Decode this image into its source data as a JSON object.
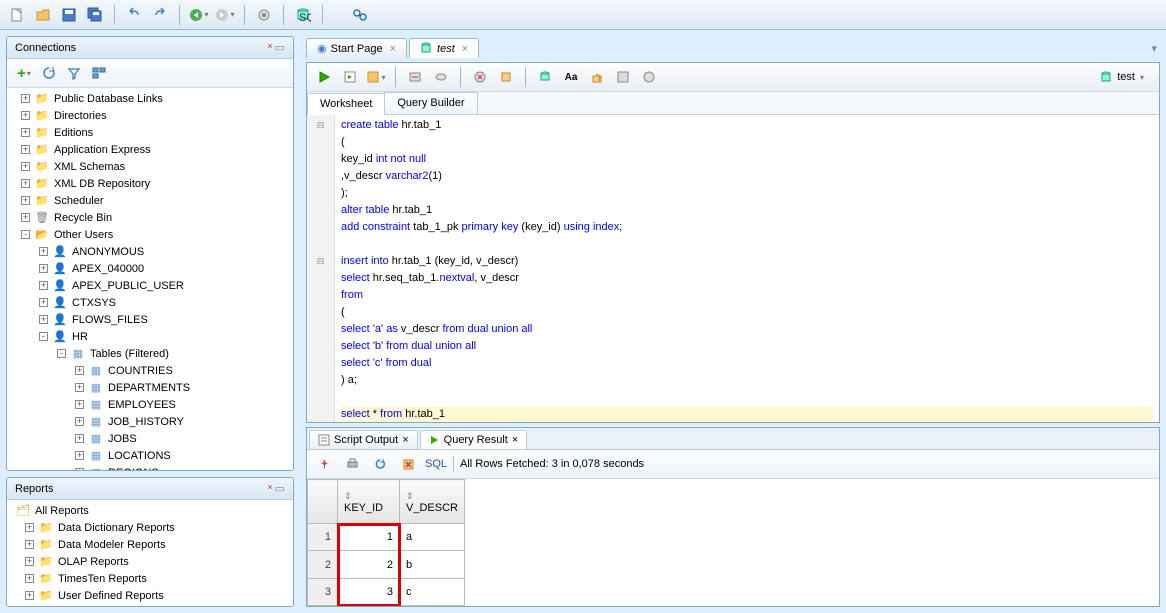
{
  "toolbar_icons": [
    "new",
    "open",
    "save",
    "saveall",
    "undo",
    "redo",
    "back",
    "fwd",
    "cfg",
    "sql",
    "find"
  ],
  "connections": {
    "title": "Connections",
    "tree": [
      {
        "lvl": 0,
        "exp": "+",
        "icon": "folder",
        "label": "Public Database Links"
      },
      {
        "lvl": 0,
        "exp": "+",
        "icon": "folder",
        "label": "Directories"
      },
      {
        "lvl": 0,
        "exp": "+",
        "icon": "folder",
        "label": "Editions"
      },
      {
        "lvl": 0,
        "exp": "+",
        "icon": "folder",
        "label": "Application Express"
      },
      {
        "lvl": 0,
        "exp": "+",
        "icon": "folder",
        "label": "XML Schemas"
      },
      {
        "lvl": 0,
        "exp": "+",
        "icon": "folder",
        "label": "XML DB Repository"
      },
      {
        "lvl": 0,
        "exp": "+",
        "icon": "folder",
        "label": "Scheduler"
      },
      {
        "lvl": 0,
        "exp": "+",
        "icon": "trash",
        "label": "Recycle Bin"
      },
      {
        "lvl": 0,
        "exp": "-",
        "icon": "folder-open",
        "label": "Other Users"
      },
      {
        "lvl": 1,
        "exp": "+",
        "icon": "user",
        "label": "ANONYMOUS"
      },
      {
        "lvl": 1,
        "exp": "+",
        "icon": "user",
        "label": "APEX_040000"
      },
      {
        "lvl": 1,
        "exp": "+",
        "icon": "user",
        "label": "APEX_PUBLIC_USER"
      },
      {
        "lvl": 1,
        "exp": "+",
        "icon": "user",
        "label": "CTXSYS"
      },
      {
        "lvl": 1,
        "exp": "+",
        "icon": "user",
        "label": "FLOWS_FILES"
      },
      {
        "lvl": 1,
        "exp": "-",
        "icon": "user",
        "label": "HR"
      },
      {
        "lvl": 2,
        "exp": "-",
        "icon": "folder-tbl",
        "label": "Tables (Filtered)"
      },
      {
        "lvl": 3,
        "exp": "+",
        "icon": "table",
        "label": "COUNTRIES"
      },
      {
        "lvl": 3,
        "exp": "+",
        "icon": "table",
        "label": "DEPARTMENTS"
      },
      {
        "lvl": 3,
        "exp": "+",
        "icon": "table",
        "label": "EMPLOYEES"
      },
      {
        "lvl": 3,
        "exp": "+",
        "icon": "table",
        "label": "JOB_HISTORY"
      },
      {
        "lvl": 3,
        "exp": "+",
        "icon": "table",
        "label": "JOBS"
      },
      {
        "lvl": 3,
        "exp": "+",
        "icon": "table",
        "label": "LOCATIONS"
      },
      {
        "lvl": 3,
        "exp": "+",
        "icon": "table",
        "label": "REGIONS"
      }
    ]
  },
  "reports": {
    "title": "Reports",
    "root": "All Reports",
    "items": [
      "Data Dictionary Reports",
      "Data Modeler Reports",
      "OLAP Reports",
      "TimesTen Reports",
      "User Defined Reports"
    ]
  },
  "editor": {
    "tabs": [
      {
        "label": "Start Page",
        "icon": "home",
        "active": false
      },
      {
        "label": "test",
        "icon": "sql",
        "active": true
      }
    ],
    "conn_selector": "test",
    "subtabs": [
      {
        "label": "Worksheet",
        "active": true
      },
      {
        "label": "Query Builder",
        "active": false
      }
    ],
    "code_lines": [
      "create table hr.tab_1",
      "(",
      "key_id int not null",
      ",v_descr varchar2(1)",
      ");",
      "alter table hr.tab_1",
      "add constraint tab_1_pk primary key (key_id) using index;",
      "",
      "insert into hr.tab_1 (key_id, v_descr)",
      "select hr.seq_tab_1.nextval, v_descr",
      "from",
      "(",
      "select 'a' as v_descr from dual union all",
      "select 'b' from dual union all",
      "select 'c' from dual",
      ") a;",
      "",
      "select * from hr.tab_1"
    ]
  },
  "results": {
    "tabs": [
      {
        "label": "Script Output",
        "active": false
      },
      {
        "label": "Query Result",
        "active": true,
        "icon": "run"
      }
    ],
    "sql_link": "SQL",
    "status": "All Rows Fetched: 3 in 0,078 seconds",
    "columns": [
      "KEY_ID",
      "V_DESCR"
    ],
    "rows": [
      {
        "n": 1,
        "key_id": 1,
        "v_descr": "a"
      },
      {
        "n": 2,
        "key_id": 2,
        "v_descr": "b"
      },
      {
        "n": 3,
        "key_id": 3,
        "v_descr": "c"
      }
    ]
  }
}
